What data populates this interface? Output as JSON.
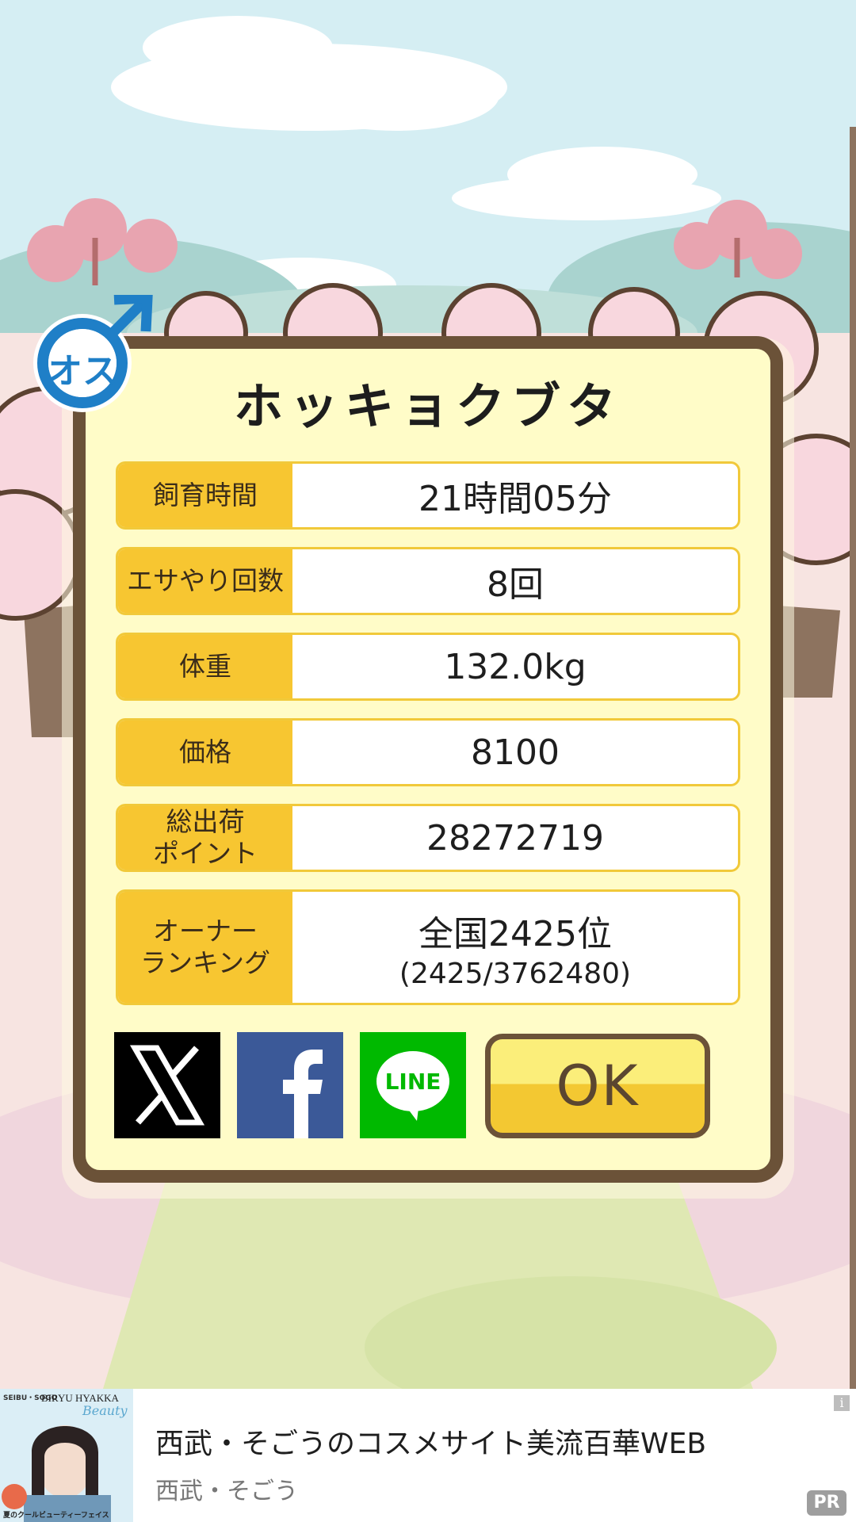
{
  "pet": {
    "gender_label": "オス",
    "name": "ホッキョクブタ"
  },
  "stats": [
    {
      "label": "飼育時間",
      "value": "21時間05分"
    },
    {
      "label": "エサやり回数",
      "value": "8回"
    },
    {
      "label": "体重",
      "value": "132.0kg"
    },
    {
      "label": "価格",
      "value": "8100"
    },
    {
      "label": "総出荷\nポイント",
      "value": "28272719"
    },
    {
      "label": "オーナー\nランキング",
      "value": "全国2425位",
      "sub": "(2425/3762480)"
    }
  ],
  "buttons": {
    "x_label": "X",
    "facebook_label": "f",
    "line_label": "LINE",
    "ok_label": "OK"
  },
  "ad": {
    "thumb_brand": "BIRYU HYAKKA",
    "thumb_script": "Beauty",
    "thumb_top": "SEIBU・SOGO",
    "thumb_caption": "夏のクールビューティーフェイス",
    "title": "西武・そごうのコスメサイト美流百華WEB",
    "advertiser": "西武・そごう",
    "info_icon": "i",
    "pr_badge": "PR"
  },
  "colors": {
    "frame": "#6b5238",
    "panel": "#fffcc8",
    "label_bg": "#f7c631",
    "accent_blue": "#1f7fc7"
  }
}
